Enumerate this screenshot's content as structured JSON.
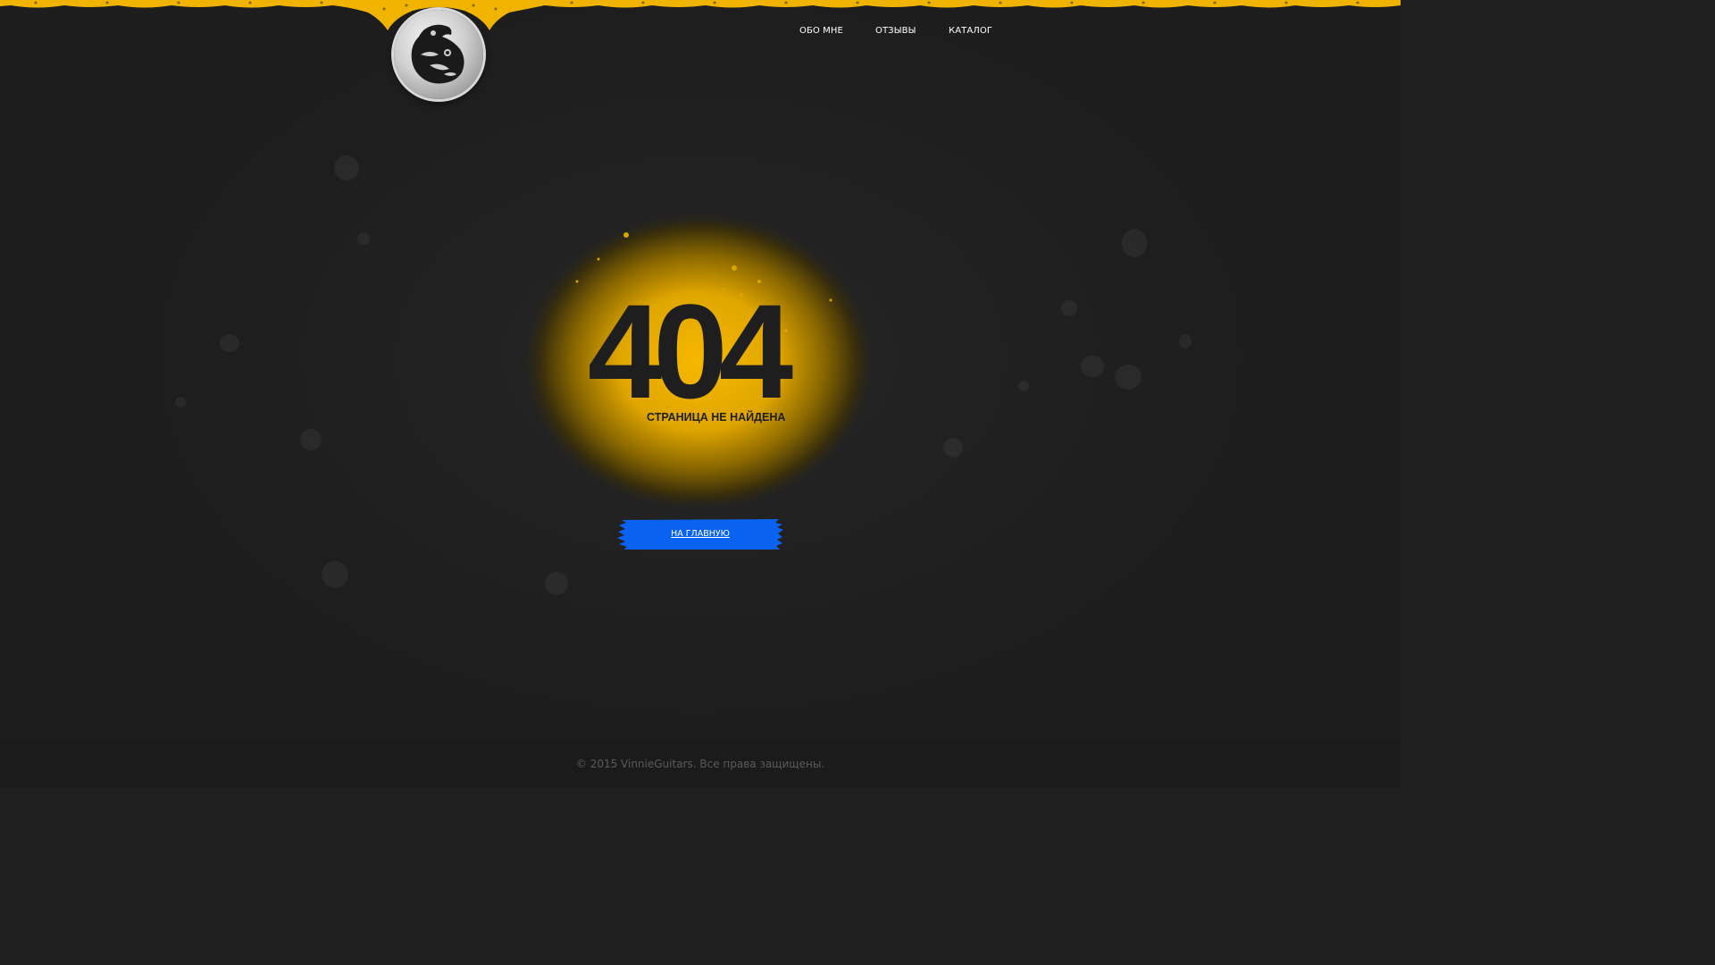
{
  "nav": {
    "items": [
      {
        "label": "ОБО МНЕ"
      },
      {
        "label": "ОТЗЫВЫ"
      },
      {
        "label": "КАТАЛОГ"
      }
    ]
  },
  "logo": {
    "icon": "raven-emblem-icon"
  },
  "error": {
    "code": "404",
    "message": "СТРАНИЦА НЕ НАЙДЕНА"
  },
  "home_button": {
    "label": "НА ГЛАВНУЮ"
  },
  "footer": {
    "copyright": "© 2015 VinnieGuitars. Все права защищены."
  },
  "colors": {
    "background": "#202020",
    "accent_yellow": "#f0b400",
    "button_blue": "#0a63f0",
    "footer_bg": "#1b1b1b",
    "footer_text": "#5a5a5a"
  }
}
